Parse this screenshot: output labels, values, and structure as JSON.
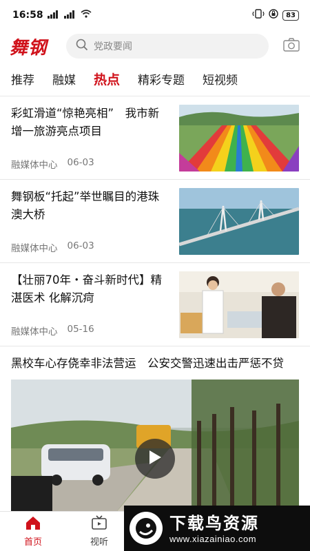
{
  "status_bar": {
    "time": "16:58",
    "signal_1": "4G",
    "signal_2": "4G",
    "battery": "83"
  },
  "header": {
    "logo_text": "舞钢",
    "search_placeholder": "党政要闻"
  },
  "tabs": [
    {
      "label": "推荐",
      "active": false
    },
    {
      "label": "融媒",
      "active": false
    },
    {
      "label": "热点",
      "active": true
    },
    {
      "label": "精彩专题",
      "active": false
    },
    {
      "label": "短视频",
      "active": false
    }
  ],
  "articles": [
    {
      "title": "彩虹滑道“惊艳亮相”　我市新增一旅游亮点项目",
      "source": "融媒体中心",
      "date": "06-03"
    },
    {
      "title": "舞钢板“托起”举世瞩目的港珠澳大桥",
      "source": "融媒体中心",
      "date": "06-03"
    },
    {
      "title": "【壮丽70年・奋斗新时代】精湛医术 化解沉疴",
      "source": "融媒体中心",
      "date": "05-16"
    }
  ],
  "video_article": {
    "title": "黑校车心存侥幸非法营运　公安交警迅速出击严惩不贷"
  },
  "bottom_nav": [
    {
      "label": "首页",
      "active": true,
      "icon": "home-icon"
    },
    {
      "label": "视听",
      "active": false,
      "icon": "tv-icon"
    }
  ],
  "watermark": {
    "title": "下载鸟资源",
    "url": "www.xiazainiao.com"
  },
  "colors": {
    "accent": "#d0121b"
  }
}
